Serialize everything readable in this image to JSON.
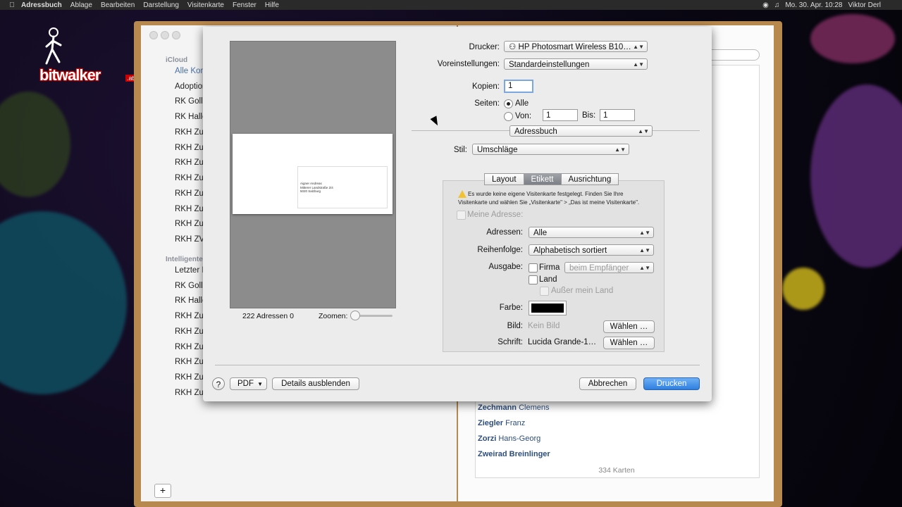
{
  "menubar": {
    "items": [
      "Adressbuch",
      "Ablage",
      "Bearbeiten",
      "Darstellung",
      "Visitenkarte",
      "Fenster",
      "Hilfe"
    ],
    "clock": "Mo. 30. Apr. 10:28",
    "user": "Viktor Derl"
  },
  "logo": {
    "text": "bitwalker",
    "suffix": ".at"
  },
  "sidebar": {
    "icloud_header": "iCloud",
    "icloud_items": [
      "Alle Kon",
      "Adoption",
      "RK Golli",
      "RK Halle",
      "RKH Zu",
      "RKH Zu",
      "RKH Zu",
      "RKH Zu",
      "RKH Zu",
      "RKH Zu",
      "RKH Zu",
      "RKH ZV"
    ],
    "smart_header": "Intelligente G",
    "smart_items": [
      "Letzter I",
      "RK Golli",
      "RK Halle",
      "RKH Zu",
      "RKH Zu",
      "RKH Zu",
      "RKH Zu",
      "RKH Zu",
      "RKH Zu"
    ],
    "add_label": "+"
  },
  "contacts": {
    "items": [
      {
        "last": "Zechmann",
        "first": "Clemens"
      },
      {
        "last": "Ziegler",
        "first": "Franz"
      },
      {
        "last": "Zorzi",
        "first": "Hans-Georg"
      },
      {
        "last": "Zweirad Breinlinger",
        "first": ""
      }
    ],
    "count": "334 Karten"
  },
  "print": {
    "printer_label": "Drucker:",
    "printer_value": "HP Photosmart Wireless B10…",
    "preset_label": "Voreinstellungen:",
    "preset_value": "Standardeinstellungen",
    "copies_label": "Kopien:",
    "copies_value": "1",
    "pages_label": "Seiten:",
    "pages_all": "Alle",
    "pages_from": "Von:",
    "from_value": "1",
    "pages_to": "Bis:",
    "to_value": "1",
    "app_section": "Adressbuch",
    "style_label": "Stil:",
    "style_value": "Umschläge",
    "tabs": [
      "Layout",
      "Etikett",
      "Ausrichtung"
    ],
    "warning_line1": "Es wurde keine eigene Visitenkarte festgelegt. Finden Sie Ihre",
    "warning_line2": "Visitenkarte und wählen Sie „Visitenkarte\" > „Das ist meine Visitenkarte\".",
    "my_address": "Meine Adresse:",
    "addresses_label": "Adressen:",
    "addresses_value": "Alle",
    "order_label": "Reihenfolge:",
    "order_value": "Alphabetisch sortiert",
    "output_label": "Ausgabe:",
    "company": "Firma",
    "company_option": "beim Empfänger",
    "country": "Land",
    "except_country": "Außer mein Land",
    "color_label": "Farbe:",
    "color_value": "#000000",
    "image_label": "Bild:",
    "image_value": "Kein Bild",
    "font_label": "Schrift:",
    "font_value": "Lucida Grande-1…",
    "choose": "Wählen …",
    "preview_count": "222 Adressen",
    "preview_page": "0",
    "zoom_label": "Zoomen:",
    "preview_addr1": "Aigner Andreas",
    "preview_addr2": "Mitterer Landstraße 2/4",
    "preview_addr3": "5020 Salzburg",
    "help": "?",
    "pdf": "PDF",
    "hide_details": "Details ausblenden",
    "cancel": "Abbrechen",
    "print": "Drucken"
  }
}
